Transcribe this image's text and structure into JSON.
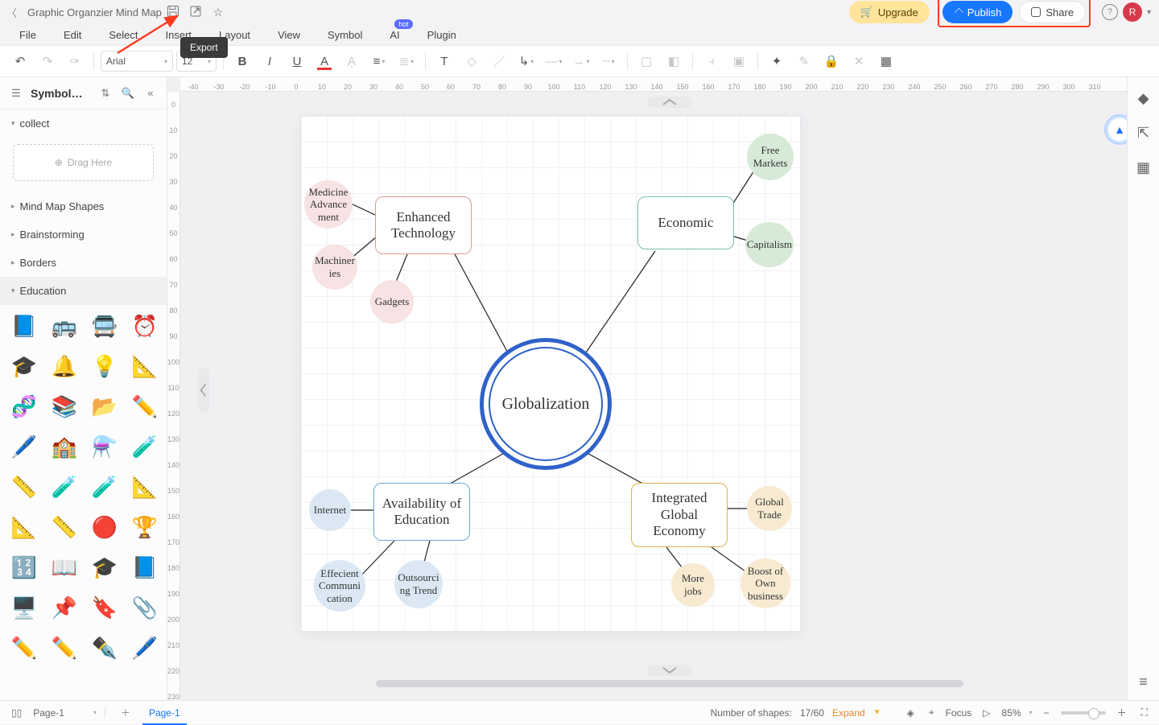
{
  "titlebar": {
    "doc_name": "Graphic Organzier Mind Map",
    "upgrade": "Upgrade",
    "publish": "Publish",
    "share": "Share",
    "avatar": "R"
  },
  "tooltip": {
    "export": "Export"
  },
  "menus": {
    "file": "File",
    "edit": "Edit",
    "select": "Select",
    "insert": "Insert",
    "layout": "Layout",
    "view": "View",
    "symbol": "Symbol",
    "ai": "AI",
    "plugin": "Plugin",
    "hot": "hot"
  },
  "toolbar": {
    "font": "Arial",
    "size": "12"
  },
  "left": {
    "title": "Symbol…",
    "sections": {
      "collect": "collect",
      "drag": "Drag Here",
      "mind": "Mind Map Shapes",
      "brain": "Brainstorming",
      "borders": "Borders",
      "edu": "Education"
    },
    "icons": [
      "📘",
      "🚌",
      "🚍",
      "⏰",
      "🎓",
      "🔔",
      "💡",
      "📐",
      "🧬",
      "📚",
      "📂",
      "✏️",
      "🖊️",
      "🏫",
      "⚗️",
      "🧪",
      "📏",
      "🧪",
      "🧪",
      "📐",
      "📐",
      "📏",
      "🔴",
      "🏆",
      "🔢",
      "📖",
      "🎓",
      "📘",
      "🖥️",
      "📌",
      "🔖",
      "📎",
      "✏️",
      "✏️",
      "✒️",
      "🖊️"
    ]
  },
  "ruler_h": [
    "-40",
    "-30",
    "-20",
    "-10",
    "0",
    "10",
    "20",
    "30",
    "40",
    "50",
    "60",
    "70",
    "80",
    "90",
    "100",
    "110",
    "120",
    "130",
    "140",
    "150",
    "160",
    "170",
    "180",
    "190",
    "200",
    "210",
    "220",
    "230",
    "240",
    "250",
    "260",
    "270",
    "280",
    "290",
    "300",
    "310"
  ],
  "ruler_v": [
    "0",
    "10",
    "20",
    "30",
    "40",
    "50",
    "60",
    "70",
    "80",
    "90",
    "100",
    "110",
    "120",
    "130",
    "140",
    "150",
    "160",
    "170",
    "180",
    "190",
    "200",
    "210",
    "220",
    "230"
  ],
  "diagram": {
    "center": "Globalization",
    "tech": {
      "title": "Enhanced Technology",
      "b1": "Medicine Advance ment",
      "b2": "Machiner ies",
      "b3": "Gadgets"
    },
    "econ": {
      "title": "Economic",
      "b1": "Free Markets",
      "b2": "Capitalism"
    },
    "avail": {
      "title": "Availability of Education",
      "b1": "Internet",
      "b2": "Effecient Communi cation",
      "b3": "Outsourci ng Trend"
    },
    "integ": {
      "title": "Integrated Global Economy",
      "b1": "Global Trade",
      "b2": "More jobs",
      "b3": "Boost of Own business"
    }
  },
  "status": {
    "page_sel": "Page-1",
    "tab": "Page-1",
    "shapes_label": "Number of shapes:",
    "shapes": "17/60",
    "expand": "Expand",
    "focus": "Focus",
    "zoom": "85%"
  }
}
